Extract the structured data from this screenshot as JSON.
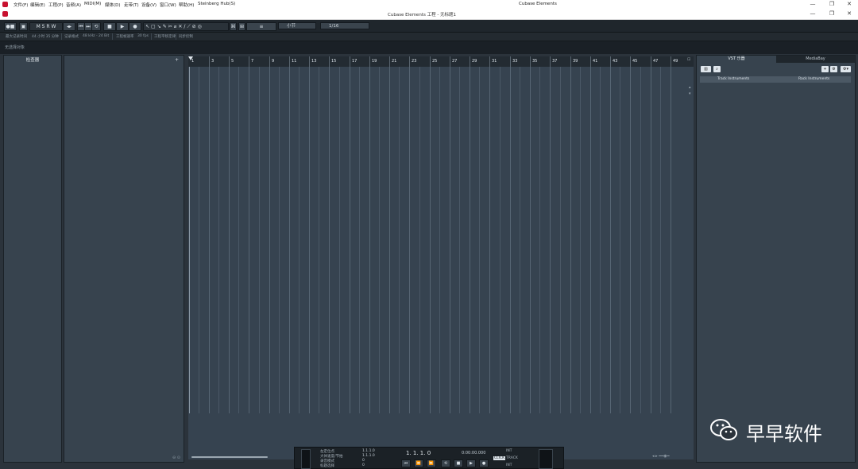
{
  "menubar": {
    "items": [
      "文件(F)",
      "编辑(E)",
      "工程(P)",
      "音频(A)",
      "MIDI(M)",
      "媒体(D)",
      "走带(T)",
      "设备(V)",
      "窗口(W)",
      "帮助(H)",
      "Steinberg Hub(S)"
    ],
    "app_title": "Cubase Elements"
  },
  "titlebar": {
    "title": "Cubase Elements 工程 - 无标题1"
  },
  "window_buttons": {
    "minimize": "—",
    "restore": "❐",
    "close": "✕"
  },
  "toolbar": {
    "grid_type": "小节",
    "quantize": "1/16"
  },
  "infobar": {
    "items": [
      "最大记录时间",
      "44 小时 35 分钟",
      "记录格式",
      "48 kHz - 24 Bit",
      "工程帧速率",
      "30 fps",
      "工程平移定律",
      "同步控制"
    ]
  },
  "statusline": {
    "text": "无选择对象"
  },
  "inspector": {
    "title": "检查器"
  },
  "ruler": {
    "bars": [
      "1",
      "3",
      "5",
      "7",
      "9",
      "11",
      "13",
      "15",
      "17",
      "19",
      "21",
      "23",
      "25",
      "27",
      "29",
      "31",
      "33",
      "35",
      "37",
      "39",
      "41",
      "43",
      "45",
      "47",
      "49"
    ]
  },
  "right_zone": {
    "tabs": [
      "VST 乐器",
      "MediaBay"
    ],
    "section_left": "Track Instruments",
    "section_right": "Rack Instruments"
  },
  "transport": {
    "markers": [
      "左定位点",
      "大体速度/节拍",
      "录音模式",
      "标题选择"
    ],
    "position": "1. 1. 1. 0",
    "time": "0:00:00.000",
    "tempo_label": "TRACK",
    "sync_left": "INT",
    "sync_right": "INT",
    "click_label": "CLICK"
  },
  "watermark": {
    "text": "早早软件"
  },
  "colors": {
    "accent": "#c8102e",
    "panel": "#37434e",
    "background": "#2b333b"
  }
}
